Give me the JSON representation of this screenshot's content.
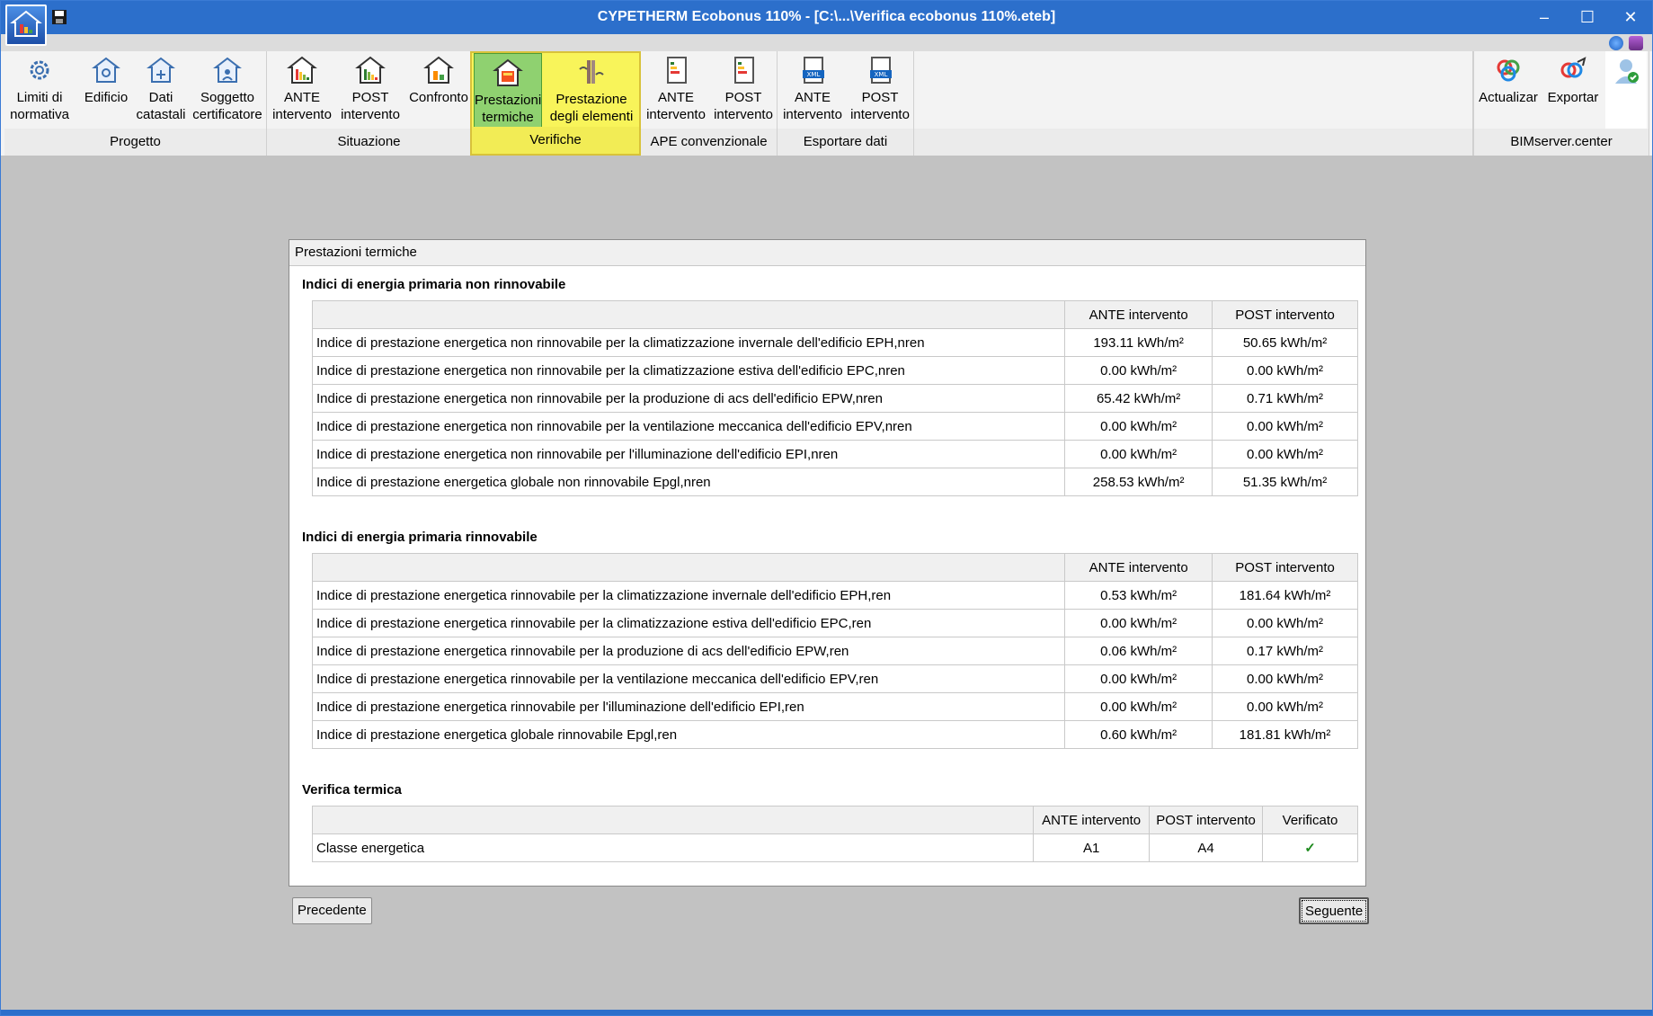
{
  "window": {
    "title": "CYPETHERM Ecobonus 110% - [C:\\...\\Verifica ecobonus 110%.eteb]",
    "minimize": "–",
    "maximize": "☐",
    "close": "✕"
  },
  "ribbon": {
    "groups": [
      {
        "label": "Progetto",
        "buttons": [
          "Limiti di\nnormativa",
          "Edificio",
          "Dati\ncatastali",
          "Soggetto\ncertificatore"
        ]
      },
      {
        "label": "Situazione",
        "buttons": [
          "ANTE\nintervento",
          "POST\nintervento",
          "Confronto"
        ]
      },
      {
        "label": "Verifiche",
        "buttons": [
          "Prestazioni\ntermiche",
          "Prestazione\ndegli elementi"
        ]
      },
      {
        "label": "APE convenzionale",
        "buttons": [
          "ANTE\nintervento",
          "POST\nintervento"
        ]
      },
      {
        "label": "Esportare dati",
        "buttons": [
          "ANTE\nintervento",
          "POST\nintervento"
        ]
      },
      {
        "label": "BIMserver.center",
        "buttons": [
          "Actualizar",
          "Exportar"
        ]
      }
    ]
  },
  "panel": {
    "title": "Prestazioni termiche",
    "sections": [
      {
        "title": "Indici di energia primaria non rinnovabile",
        "headers": [
          "",
          "ANTE intervento",
          "POST intervento"
        ],
        "rows": [
          [
            "Indice di prestazione energetica non rinnovabile per la climatizzazione invernale dell'edificio EPH,nren",
            "193.11 kWh/m²",
            "50.65 kWh/m²"
          ],
          [
            "Indice di prestazione energetica non rinnovabile per la climatizzazione estiva dell'edificio EPC,nren",
            "0.00 kWh/m²",
            "0.00 kWh/m²"
          ],
          [
            "Indice di prestazione energetica non rinnovabile per la produzione di acs dell'edificio EPW,nren",
            "65.42 kWh/m²",
            "0.71 kWh/m²"
          ],
          [
            "Indice di prestazione energetica non rinnovabile per la ventilazione meccanica dell'edificio EPV,nren",
            "0.00 kWh/m²",
            "0.00 kWh/m²"
          ],
          [
            "Indice di prestazione energetica non rinnovabile per l'illuminazione dell'edificio EPI,nren",
            "0.00 kWh/m²",
            "0.00 kWh/m²"
          ],
          [
            "Indice di prestazione energetica globale non rinnovabile Epgl,nren",
            "258.53 kWh/m²",
            "51.35 kWh/m²"
          ]
        ]
      },
      {
        "title": "Indici di energia primaria rinnovabile",
        "headers": [
          "",
          "ANTE intervento",
          "POST intervento"
        ],
        "rows": [
          [
            "Indice di prestazione energetica rinnovabile per la climatizzazione invernale dell'edificio EPH,ren",
            "0.53 kWh/m²",
            "181.64 kWh/m²"
          ],
          [
            "Indice di prestazione energetica rinnovabile per la climatizzazione estiva dell'edificio EPC,ren",
            "0.00 kWh/m²",
            "0.00 kWh/m²"
          ],
          [
            "Indice di prestazione energetica rinnovabile per la produzione di acs dell'edificio EPW,ren",
            "0.06 kWh/m²",
            "0.17 kWh/m²"
          ],
          [
            "Indice di prestazione energetica rinnovabile per la ventilazione meccanica dell'edificio EPV,ren",
            "0.00 kWh/m²",
            "0.00 kWh/m²"
          ],
          [
            "Indice di prestazione energetica rinnovabile per l'illuminazione dell'edificio EPI,ren",
            "0.00 kWh/m²",
            "0.00 kWh/m²"
          ],
          [
            "Indice di prestazione energetica globale rinnovabile Epgl,ren",
            "0.60 kWh/m²",
            "181.81 kWh/m²"
          ]
        ]
      },
      {
        "title": "Verifica termica",
        "headers": [
          "",
          "ANTE intervento",
          "POST intervento",
          "Verificato"
        ],
        "rows": [
          [
            "Classe energetica",
            "A1",
            "A4",
            "✓"
          ]
        ]
      }
    ]
  },
  "buttons": {
    "previous": "Precedente",
    "next": "Seguente"
  },
  "colors": {
    "titlebar": "#2c6fcb",
    "highlight_group": "#f8f45a",
    "active_button": "#8fd170",
    "check": "#1d8a1d"
  }
}
